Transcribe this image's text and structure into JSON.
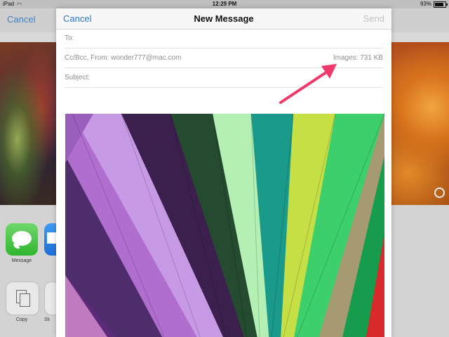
{
  "status_bar": {
    "device": "iPad",
    "time": "12:29 PM",
    "battery": "93%"
  },
  "background": {
    "cancel_label": "Cancel",
    "share_apps": [
      "Message"
    ],
    "actions": [
      "Copy",
      "Sli"
    ]
  },
  "compose": {
    "cancel_label": "Cancel",
    "title": "New Message",
    "send_label": "Send",
    "to_label": "To:",
    "cc_from_label": "Cc/Bcc, From:",
    "from_address": "wonder777@mac.com",
    "images_size": "Images:  731 KB",
    "subject_label": "Subject:"
  },
  "colors": {
    "accent": "#2a7bd1",
    "annotation_arrow": "#f0386b"
  },
  "icons": [
    "wifi-icon",
    "battery-icon",
    "messages-app-icon",
    "mail-app-icon",
    "copy-icon"
  ]
}
